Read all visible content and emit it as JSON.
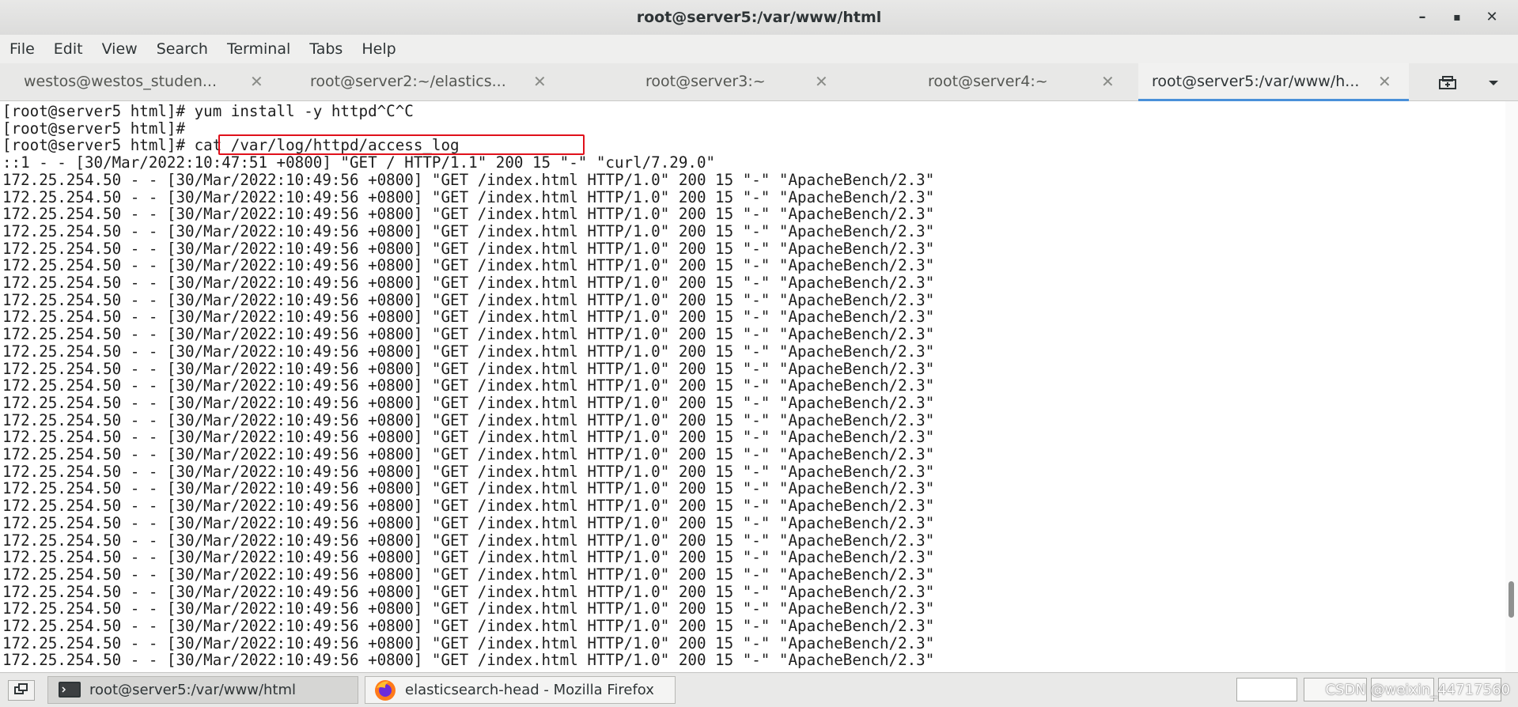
{
  "window": {
    "title": "root@server5:/var/www/html",
    "minimize_glyph": "–",
    "maximize_glyph": "▪",
    "close_glyph": "✕"
  },
  "menu": [
    "File",
    "Edit",
    "View",
    "Search",
    "Terminal",
    "Tabs",
    "Help"
  ],
  "tabs": [
    {
      "label": "westos@westos_studen...",
      "active": false
    },
    {
      "label": "root@server2:~/elastics...",
      "active": false
    },
    {
      "label": "root@server3:~",
      "active": false
    },
    {
      "label": "root@server4:~",
      "active": false
    },
    {
      "label": "root@server5:/var/www/h...",
      "active": true
    }
  ],
  "tab_close_glyph": "✕",
  "terminal": {
    "lines": [
      "[root@server5 html]# yum install -y httpd^C^C",
      "[root@server5 html]#",
      "[root@server5 html]# cat /var/log/httpd/access_log",
      "::1 - - [30/Mar/2022:10:47:51 +0800] \"GET / HTTP/1.1\" 200 15 \"-\" \"curl/7.29.0\"",
      "172.25.254.50 - - [30/Mar/2022:10:49:56 +0800] \"GET /index.html HTTP/1.0\" 200 15 \"-\" \"ApacheBench/2.3\"",
      "172.25.254.50 - - [30/Mar/2022:10:49:56 +0800] \"GET /index.html HTTP/1.0\" 200 15 \"-\" \"ApacheBench/2.3\"",
      "172.25.254.50 - - [30/Mar/2022:10:49:56 +0800] \"GET /index.html HTTP/1.0\" 200 15 \"-\" \"ApacheBench/2.3\"",
      "172.25.254.50 - - [30/Mar/2022:10:49:56 +0800] \"GET /index.html HTTP/1.0\" 200 15 \"-\" \"ApacheBench/2.3\"",
      "172.25.254.50 - - [30/Mar/2022:10:49:56 +0800] \"GET /index.html HTTP/1.0\" 200 15 \"-\" \"ApacheBench/2.3\"",
      "172.25.254.50 - - [30/Mar/2022:10:49:56 +0800] \"GET /index.html HTTP/1.0\" 200 15 \"-\" \"ApacheBench/2.3\"",
      "172.25.254.50 - - [30/Mar/2022:10:49:56 +0800] \"GET /index.html HTTP/1.0\" 200 15 \"-\" \"ApacheBench/2.3\"",
      "172.25.254.50 - - [30/Mar/2022:10:49:56 +0800] \"GET /index.html HTTP/1.0\" 200 15 \"-\" \"ApacheBench/2.3\"",
      "172.25.254.50 - - [30/Mar/2022:10:49:56 +0800] \"GET /index.html HTTP/1.0\" 200 15 \"-\" \"ApacheBench/2.3\"",
      "172.25.254.50 - - [30/Mar/2022:10:49:56 +0800] \"GET /index.html HTTP/1.0\" 200 15 \"-\" \"ApacheBench/2.3\"",
      "172.25.254.50 - - [30/Mar/2022:10:49:56 +0800] \"GET /index.html HTTP/1.0\" 200 15 \"-\" \"ApacheBench/2.3\"",
      "172.25.254.50 - - [30/Mar/2022:10:49:56 +0800] \"GET /index.html HTTP/1.0\" 200 15 \"-\" \"ApacheBench/2.3\"",
      "172.25.254.50 - - [30/Mar/2022:10:49:56 +0800] \"GET /index.html HTTP/1.0\" 200 15 \"-\" \"ApacheBench/2.3\"",
      "172.25.254.50 - - [30/Mar/2022:10:49:56 +0800] \"GET /index.html HTTP/1.0\" 200 15 \"-\" \"ApacheBench/2.3\"",
      "172.25.254.50 - - [30/Mar/2022:10:49:56 +0800] \"GET /index.html HTTP/1.0\" 200 15 \"-\" \"ApacheBench/2.3\"",
      "172.25.254.50 - - [30/Mar/2022:10:49:56 +0800] \"GET /index.html HTTP/1.0\" 200 15 \"-\" \"ApacheBench/2.3\"",
      "172.25.254.50 - - [30/Mar/2022:10:49:56 +0800] \"GET /index.html HTTP/1.0\" 200 15 \"-\" \"ApacheBench/2.3\"",
      "172.25.254.50 - - [30/Mar/2022:10:49:56 +0800] \"GET /index.html HTTP/1.0\" 200 15 \"-\" \"ApacheBench/2.3\"",
      "172.25.254.50 - - [30/Mar/2022:10:49:56 +0800] \"GET /index.html HTTP/1.0\" 200 15 \"-\" \"ApacheBench/2.3\"",
      "172.25.254.50 - - [30/Mar/2022:10:49:56 +0800] \"GET /index.html HTTP/1.0\" 200 15 \"-\" \"ApacheBench/2.3\"",
      "172.25.254.50 - - [30/Mar/2022:10:49:56 +0800] \"GET /index.html HTTP/1.0\" 200 15 \"-\" \"ApacheBench/2.3\"",
      "172.25.254.50 - - [30/Mar/2022:10:49:56 +0800] \"GET /index.html HTTP/1.0\" 200 15 \"-\" \"ApacheBench/2.3\"",
      "172.25.254.50 - - [30/Mar/2022:10:49:56 +0800] \"GET /index.html HTTP/1.0\" 200 15 \"-\" \"ApacheBench/2.3\"",
      "172.25.254.50 - - [30/Mar/2022:10:49:56 +0800] \"GET /index.html HTTP/1.0\" 200 15 \"-\" \"ApacheBench/2.3\"",
      "172.25.254.50 - - [30/Mar/2022:10:49:56 +0800] \"GET /index.html HTTP/1.0\" 200 15 \"-\" \"ApacheBench/2.3\"",
      "172.25.254.50 - - [30/Mar/2022:10:49:56 +0800] \"GET /index.html HTTP/1.0\" 200 15 \"-\" \"ApacheBench/2.3\"",
      "172.25.254.50 - - [30/Mar/2022:10:49:56 +0800] \"GET /index.html HTTP/1.0\" 200 15 \"-\" \"ApacheBench/2.3\"",
      "172.25.254.50 - - [30/Mar/2022:10:49:56 +0800] \"GET /index.html HTTP/1.0\" 200 15 \"-\" \"ApacheBench/2.3\"",
      "172.25.254.50 - - [30/Mar/2022:10:49:56 +0800] \"GET /index.html HTTP/1.0\" 200 15 \"-\" \"ApacheBench/2.3\""
    ],
    "highlight_color": "#e0101b"
  },
  "taskbar": {
    "tasks": [
      {
        "label": "root@server5:/var/www/html",
        "icon": "terminal-icon",
        "active": true
      },
      {
        "label": "elasticsearch-head - Mozilla Firefox",
        "icon": "firefox-icon",
        "active": false
      }
    ],
    "watermark": "CSDN @weixin_44717560"
  },
  "colors": {
    "accent": "#4a90d9",
    "terminal_bg": "#ffffff",
    "terminal_fg": "#1e1e1e"
  }
}
